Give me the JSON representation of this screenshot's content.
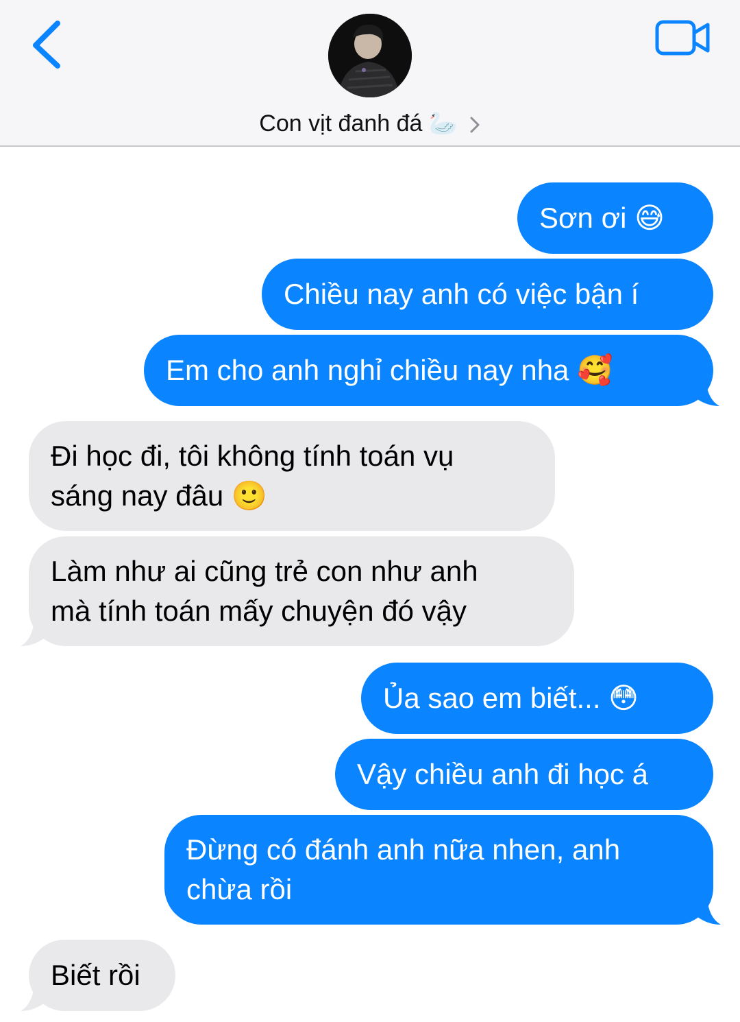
{
  "header": {
    "back_icon": "chevron-left-icon",
    "contact_name": "Con vịt đanh đá",
    "contact_emoji": "🦢",
    "video_icon": "video-camera-icon",
    "accent": "#0a84ff"
  },
  "messages": [
    {
      "from": "me",
      "text": "Sơn ơi 😅"
    },
    {
      "from": "me",
      "text": "Chiều nay anh có việc bận í"
    },
    {
      "from": "me",
      "text": "Em cho anh nghỉ chiều nay nha 🥰"
    },
    {
      "from": "them",
      "text": "Đi học đi, tôi không tính toán vụ",
      "text2": "sáng nay đâu 🙂"
    },
    {
      "from": "them",
      "text": "Làm như ai cũng trẻ con như anh",
      "text2": "mà tính toán mấy chuyện đó vậy"
    },
    {
      "from": "me",
      "text": "Ủa sao em biết... 😳"
    },
    {
      "from": "me",
      "text": "Vậy chiều anh đi học á"
    },
    {
      "from": "me",
      "text": "Đừng có đánh anh nữa nhen, anh",
      "text2": "chừa rồi"
    },
    {
      "from": "them",
      "text": "Biết rồi"
    }
  ],
  "colors": {
    "outgoing": "#0a84ff",
    "incoming": "#e9e9eb"
  }
}
